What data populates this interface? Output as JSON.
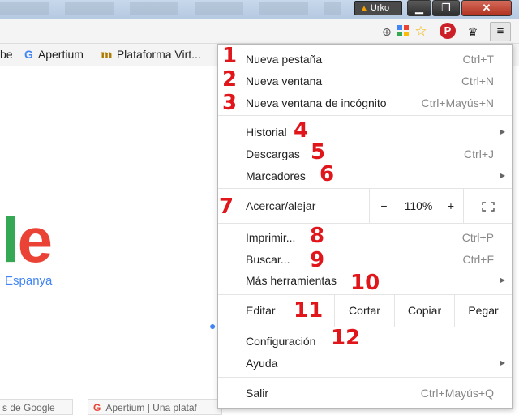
{
  "window": {
    "user_name": "Urko",
    "minimize_icon": "minimize-icon",
    "maximize_icon": "maximize-icon",
    "close_icon": "close-icon"
  },
  "toolbar": {
    "zoom_icon": "zoom-icon",
    "extension_icon": "extension-icon",
    "star_icon": "star-icon",
    "pinterest_icon": "pinterest-icon",
    "crown_icon": "crown-icon",
    "menu_icon": "menu-icon"
  },
  "bookmarks": [
    {
      "label": "be",
      "icon": ""
    },
    {
      "label": "Apertium",
      "icon": "G"
    },
    {
      "label": "Plataforma Virt...",
      "icon": "m"
    }
  ],
  "page": {
    "logo_fragment_l": "l",
    "logo_fragment_e": "e",
    "country": "Espanya",
    "tile_left": "s de Google",
    "tile_right": "Apertium | Una plataf"
  },
  "menu": {
    "new_tab": {
      "label": "Nueva pestaña",
      "shortcut": "Ctrl+T"
    },
    "new_window": {
      "label": "Nueva ventana",
      "shortcut": "Ctrl+N"
    },
    "incognito": {
      "label": "Nueva ventana de incógnito",
      "shortcut": "Ctrl+Mayús+N"
    },
    "history": {
      "label": "Historial"
    },
    "downloads": {
      "label": "Descargas",
      "shortcut": "Ctrl+J"
    },
    "bookmarks": {
      "label": "Marcadores"
    },
    "zoom": {
      "label": "Acercar/alejar",
      "minus": "−",
      "value": "110%",
      "plus": "+",
      "fullscreen_icon": "fullscreen-icon"
    },
    "print": {
      "label": "Imprimir...",
      "shortcut": "Ctrl+P"
    },
    "find": {
      "label": "Buscar...",
      "shortcut": "Ctrl+F"
    },
    "more_tools": {
      "label": "Más herramientas"
    },
    "edit": {
      "label": "Editar",
      "cut": "Cortar",
      "copy": "Copiar",
      "paste": "Pegar"
    },
    "settings": {
      "label": "Configuración"
    },
    "help": {
      "label": "Ayuda"
    },
    "exit": {
      "label": "Salir",
      "shortcut": "Ctrl+Mayús+Q"
    }
  },
  "annotations": [
    "1",
    "2",
    "3",
    "4",
    "5",
    "6",
    "7",
    "8",
    "9",
    "10",
    "11",
    "12"
  ],
  "colors": {
    "annotation_red": "#e0161b",
    "google_blue": "#4285f4",
    "google_green": "#34a853",
    "google_red": "#ea4335"
  }
}
